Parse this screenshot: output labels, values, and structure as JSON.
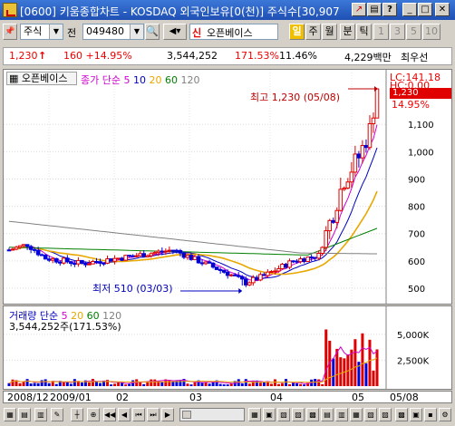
{
  "window": {
    "title": "[0600] 키움종합차트 - KOSDAQ 외국인보유[0(천)] 주식수[30,907"
  },
  "toolbar": {
    "market": "주식",
    "prefix": "전",
    "code": "049480",
    "credit_mark": "신",
    "stock_name": "오픈베이스",
    "period_day": "일",
    "period_week": "주",
    "period_month": "월",
    "minute": "분",
    "tick": "틱",
    "n1": "1",
    "n3": "3",
    "n5": "5",
    "n10": "10"
  },
  "quote": {
    "price": "1,230",
    "change": "160 +14.95%",
    "volume": "3,544,252",
    "volume_ratio": "171.53%",
    "turnover": "11.46%",
    "amount": "4,229백만",
    "credit": "최우선"
  },
  "price_panel": {
    "name": "오픈베이스",
    "legend_main": "종가 단순",
    "ma": [
      "5",
      "10",
      "20",
      "60",
      "120"
    ],
    "lc": "LC:141.18",
    "hc": "HC:0.00",
    "current_tag": "1,230",
    "current_pct": "14.95%",
    "high_note": "최고 1,230 (05/08)",
    "low_note": "최저 510 (03/03)"
  },
  "volume_panel": {
    "name": "거래량 단순",
    "ma": [
      "5",
      "20",
      "60",
      "120"
    ],
    "readout": "3,544,252주(171.53%)"
  },
  "x_labels": [
    "2008/12",
    "2009/01",
    "02",
    "03",
    "04",
    "05",
    "05/08"
  ],
  "colors": {
    "up": "#e00000",
    "down": "#0000d8",
    "ma5": "#d000d0",
    "ma10": "#0000c0",
    "ma20": "#e8a800",
    "ma60": "#008000",
    "ma120": "#808080",
    "accent": "#f0c000"
  },
  "chart_data": {
    "type": "candlestick",
    "price_axis": {
      "ticks": [
        500,
        600,
        700,
        800,
        900,
        1000,
        1100
      ],
      "labels": [
        "500",
        "600",
        "700",
        "800",
        "900",
        "1,000",
        "1,100"
      ],
      "range": [
        470,
        1260
      ]
    },
    "volume_axis": {
      "ticks": [
        2500000,
        5000000
      ],
      "labels": [
        "2,500K",
        "5,000K"
      ],
      "range": [
        0,
        7000000
      ]
    },
    "high": 1230,
    "low": 510,
    "last_close": 1230,
    "last_volume": 3544252
  }
}
